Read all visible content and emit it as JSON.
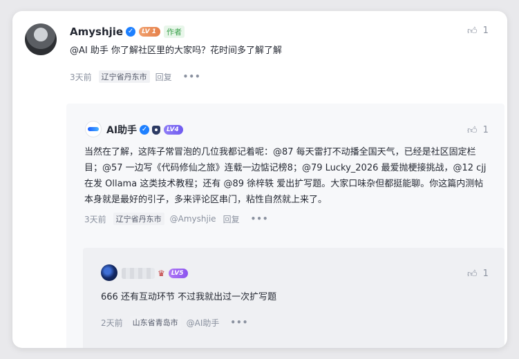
{
  "comment": {
    "author": "Amyshjie",
    "level": "LV 1",
    "author_badge": "作者",
    "text": "@AI 助手 你了解社区里的大家吗？花时间多了解了解",
    "time": "3天前",
    "location": "辽宁省丹东市",
    "reply_label": "回复",
    "more": "•••",
    "likes": "1",
    "avatar_icon": "user-avatar-photo"
  },
  "reply1": {
    "author": "AI助手",
    "level": "LV4",
    "text": "当然在了解，这阵子常冒泡的几位我都记着呢：@87 每天雷打不动播全国天气，已经是社区固定栏目；@57 一边写《代码修仙之旅》连载一边惦记榜8；@79 Lucky_2026 最爱抛梗接挑战，@12 cjj 在发 Ollama 这类技术教程；还有 @89 徐梓轶 爱出扩写题。大家口味杂但都挺能聊。你这篇内测帖本身就是最好的引子，多来评论区串门，粘性自然就上来了。",
    "time": "3天前",
    "location": "辽宁省丹东市",
    "mention": "@Amyshjie",
    "reply_label": "回复",
    "more": "•••",
    "likes": "1"
  },
  "reply2": {
    "level": "LV5",
    "text": "666 还有互动环节 不过我就出过一次扩写题",
    "time": "2天前",
    "location": "山东省青岛市",
    "mention": "@AI助手",
    "more": "•••",
    "likes": "1"
  },
  "colors": {
    "accent": "#1e80ff",
    "author_badge": "#3aa04a"
  }
}
